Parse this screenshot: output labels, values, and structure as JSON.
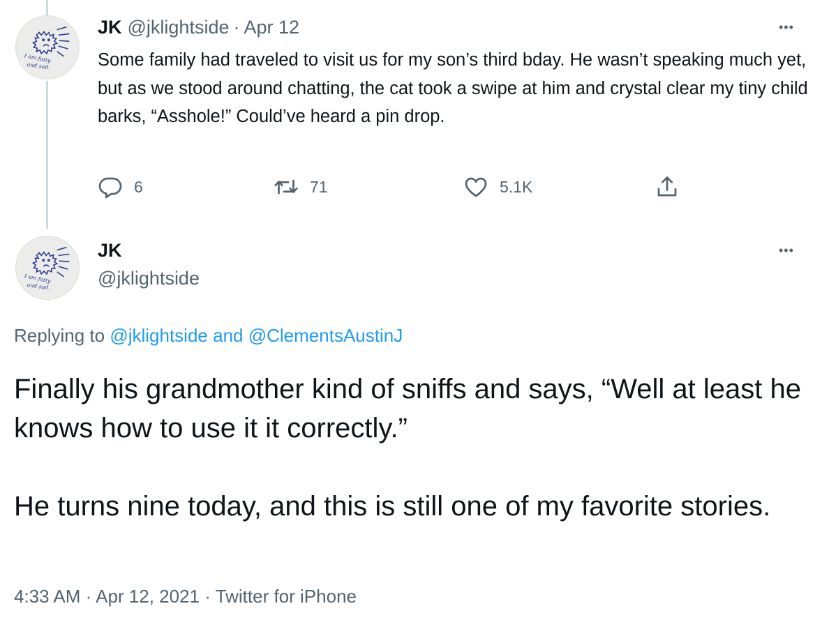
{
  "tweet1": {
    "name": "JK",
    "handle": "@jklightside",
    "separator": "·",
    "date": "Apr 12",
    "text": "Some family had traveled to visit us for my son’s third bday. He wasn’t speaking much yet, but as we stood around chatting, the cat took a swipe at him and crystal clear my tiny child barks, “Asshole!” Could’ve heard a pin drop.",
    "more": "•••",
    "actions": {
      "reply_count": "6",
      "retweet_count": "71",
      "like_count": "5.1K"
    }
  },
  "tweet2": {
    "name": "JK",
    "handle": "@jklightside",
    "more": "•••",
    "replying_prefix": "Replying to",
    "replying_user1": "@jklightside",
    "replying_and": "and",
    "replying_user2": "@ClementsAustinJ",
    "paragraph1": "Finally his grandmother kind of sniffs and says, “Well at least he knows how to use it it correctly.”",
    "paragraph2": "He turns nine today, and this is still one of my favorite stories.",
    "time": "4:33 AM",
    "meta_sep": "·",
    "full_date": "Apr 12, 2021",
    "source": "Twitter for iPhone"
  },
  "avatar": {
    "caption_line1": "I am fatty",
    "caption_line2": "and sad."
  },
  "icons": {
    "reply": "reply-icon",
    "retweet": "retweet-icon",
    "like": "heart-icon",
    "share": "share-icon",
    "more": "more-icon"
  },
  "colors": {
    "text": "#0f1419",
    "muted": "#536471",
    "link": "#1d9bf0",
    "thread_line": "#cfd9de"
  }
}
